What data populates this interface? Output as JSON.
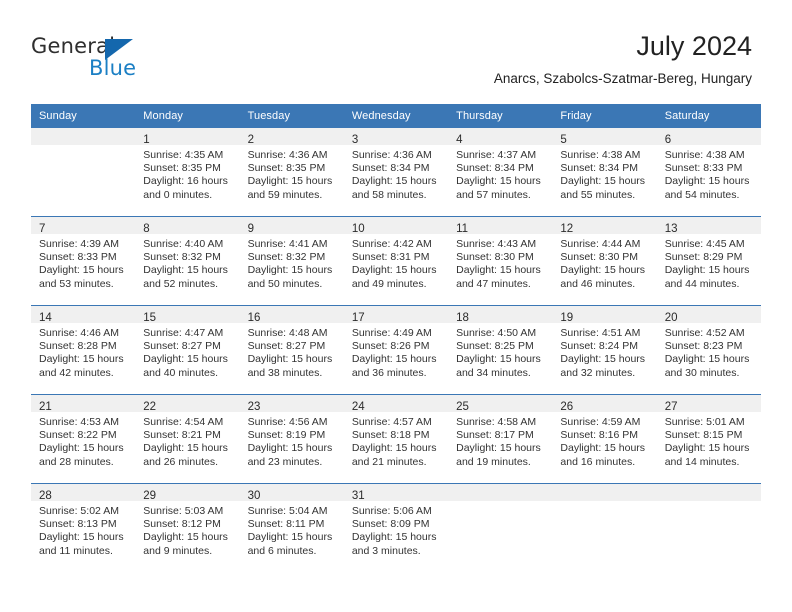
{
  "brand": {
    "name_top": "General",
    "name_bottom": "Blue",
    "mark": "triangle-flag",
    "color_primary": "#1467ad",
    "color_secondary": "#1b7fc4"
  },
  "header": {
    "title": "July 2024",
    "subtitle": "Anarcs, Szabolcs-Szatmar-Bereg, Hungary"
  },
  "calendar": {
    "accent_color": "#3b77b5",
    "band_color": "#f0f0f0",
    "weekday_headers": [
      "Sunday",
      "Monday",
      "Tuesday",
      "Wednesday",
      "Thursday",
      "Friday",
      "Saturday"
    ],
    "weeks": [
      [
        {
          "day": "",
          "sunrise": "",
          "sunset": "",
          "daylight_1": "",
          "daylight_2": ""
        },
        {
          "day": "1",
          "sunrise": "Sunrise: 4:35 AM",
          "sunset": "Sunset: 8:35 PM",
          "daylight_1": "Daylight: 16 hours",
          "daylight_2": "and 0 minutes."
        },
        {
          "day": "2",
          "sunrise": "Sunrise: 4:36 AM",
          "sunset": "Sunset: 8:35 PM",
          "daylight_1": "Daylight: 15 hours",
          "daylight_2": "and 59 minutes."
        },
        {
          "day": "3",
          "sunrise": "Sunrise: 4:36 AM",
          "sunset": "Sunset: 8:34 PM",
          "daylight_1": "Daylight: 15 hours",
          "daylight_2": "and 58 minutes."
        },
        {
          "day": "4",
          "sunrise": "Sunrise: 4:37 AM",
          "sunset": "Sunset: 8:34 PM",
          "daylight_1": "Daylight: 15 hours",
          "daylight_2": "and 57 minutes."
        },
        {
          "day": "5",
          "sunrise": "Sunrise: 4:38 AM",
          "sunset": "Sunset: 8:34 PM",
          "daylight_1": "Daylight: 15 hours",
          "daylight_2": "and 55 minutes."
        },
        {
          "day": "6",
          "sunrise": "Sunrise: 4:38 AM",
          "sunset": "Sunset: 8:33 PM",
          "daylight_1": "Daylight: 15 hours",
          "daylight_2": "and 54 minutes."
        }
      ],
      [
        {
          "day": "7",
          "sunrise": "Sunrise: 4:39 AM",
          "sunset": "Sunset: 8:33 PM",
          "daylight_1": "Daylight: 15 hours",
          "daylight_2": "and 53 minutes."
        },
        {
          "day": "8",
          "sunrise": "Sunrise: 4:40 AM",
          "sunset": "Sunset: 8:32 PM",
          "daylight_1": "Daylight: 15 hours",
          "daylight_2": "and 52 minutes."
        },
        {
          "day": "9",
          "sunrise": "Sunrise: 4:41 AM",
          "sunset": "Sunset: 8:32 PM",
          "daylight_1": "Daylight: 15 hours",
          "daylight_2": "and 50 minutes."
        },
        {
          "day": "10",
          "sunrise": "Sunrise: 4:42 AM",
          "sunset": "Sunset: 8:31 PM",
          "daylight_1": "Daylight: 15 hours",
          "daylight_2": "and 49 minutes."
        },
        {
          "day": "11",
          "sunrise": "Sunrise: 4:43 AM",
          "sunset": "Sunset: 8:30 PM",
          "daylight_1": "Daylight: 15 hours",
          "daylight_2": "and 47 minutes."
        },
        {
          "day": "12",
          "sunrise": "Sunrise: 4:44 AM",
          "sunset": "Sunset: 8:30 PM",
          "daylight_1": "Daylight: 15 hours",
          "daylight_2": "and 46 minutes."
        },
        {
          "day": "13",
          "sunrise": "Sunrise: 4:45 AM",
          "sunset": "Sunset: 8:29 PM",
          "daylight_1": "Daylight: 15 hours",
          "daylight_2": "and 44 minutes."
        }
      ],
      [
        {
          "day": "14",
          "sunrise": "Sunrise: 4:46 AM",
          "sunset": "Sunset: 8:28 PM",
          "daylight_1": "Daylight: 15 hours",
          "daylight_2": "and 42 minutes."
        },
        {
          "day": "15",
          "sunrise": "Sunrise: 4:47 AM",
          "sunset": "Sunset: 8:27 PM",
          "daylight_1": "Daylight: 15 hours",
          "daylight_2": "and 40 minutes."
        },
        {
          "day": "16",
          "sunrise": "Sunrise: 4:48 AM",
          "sunset": "Sunset: 8:27 PM",
          "daylight_1": "Daylight: 15 hours",
          "daylight_2": "and 38 minutes."
        },
        {
          "day": "17",
          "sunrise": "Sunrise: 4:49 AM",
          "sunset": "Sunset: 8:26 PM",
          "daylight_1": "Daylight: 15 hours",
          "daylight_2": "and 36 minutes."
        },
        {
          "day": "18",
          "sunrise": "Sunrise: 4:50 AM",
          "sunset": "Sunset: 8:25 PM",
          "daylight_1": "Daylight: 15 hours",
          "daylight_2": "and 34 minutes."
        },
        {
          "day": "19",
          "sunrise": "Sunrise: 4:51 AM",
          "sunset": "Sunset: 8:24 PM",
          "daylight_1": "Daylight: 15 hours",
          "daylight_2": "and 32 minutes."
        },
        {
          "day": "20",
          "sunrise": "Sunrise: 4:52 AM",
          "sunset": "Sunset: 8:23 PM",
          "daylight_1": "Daylight: 15 hours",
          "daylight_2": "and 30 minutes."
        }
      ],
      [
        {
          "day": "21",
          "sunrise": "Sunrise: 4:53 AM",
          "sunset": "Sunset: 8:22 PM",
          "daylight_1": "Daylight: 15 hours",
          "daylight_2": "and 28 minutes."
        },
        {
          "day": "22",
          "sunrise": "Sunrise: 4:54 AM",
          "sunset": "Sunset: 8:21 PM",
          "daylight_1": "Daylight: 15 hours",
          "daylight_2": "and 26 minutes."
        },
        {
          "day": "23",
          "sunrise": "Sunrise: 4:56 AM",
          "sunset": "Sunset: 8:19 PM",
          "daylight_1": "Daylight: 15 hours",
          "daylight_2": "and 23 minutes."
        },
        {
          "day": "24",
          "sunrise": "Sunrise: 4:57 AM",
          "sunset": "Sunset: 8:18 PM",
          "daylight_1": "Daylight: 15 hours",
          "daylight_2": "and 21 minutes."
        },
        {
          "day": "25",
          "sunrise": "Sunrise: 4:58 AM",
          "sunset": "Sunset: 8:17 PM",
          "daylight_1": "Daylight: 15 hours",
          "daylight_2": "and 19 minutes."
        },
        {
          "day": "26",
          "sunrise": "Sunrise: 4:59 AM",
          "sunset": "Sunset: 8:16 PM",
          "daylight_1": "Daylight: 15 hours",
          "daylight_2": "and 16 minutes."
        },
        {
          "day": "27",
          "sunrise": "Sunrise: 5:01 AM",
          "sunset": "Sunset: 8:15 PM",
          "daylight_1": "Daylight: 15 hours",
          "daylight_2": "and 14 minutes."
        }
      ],
      [
        {
          "day": "28",
          "sunrise": "Sunrise: 5:02 AM",
          "sunset": "Sunset: 8:13 PM",
          "daylight_1": "Daylight: 15 hours",
          "daylight_2": "and 11 minutes."
        },
        {
          "day": "29",
          "sunrise": "Sunrise: 5:03 AM",
          "sunset": "Sunset: 8:12 PM",
          "daylight_1": "Daylight: 15 hours",
          "daylight_2": "and 9 minutes."
        },
        {
          "day": "30",
          "sunrise": "Sunrise: 5:04 AM",
          "sunset": "Sunset: 8:11 PM",
          "daylight_1": "Daylight: 15 hours",
          "daylight_2": "and 6 minutes."
        },
        {
          "day": "31",
          "sunrise": "Sunrise: 5:06 AM",
          "sunset": "Sunset: 8:09 PM",
          "daylight_1": "Daylight: 15 hours",
          "daylight_2": "and 3 minutes."
        },
        {
          "day": "",
          "sunrise": "",
          "sunset": "",
          "daylight_1": "",
          "daylight_2": ""
        },
        {
          "day": "",
          "sunrise": "",
          "sunset": "",
          "daylight_1": "",
          "daylight_2": ""
        },
        {
          "day": "",
          "sunrise": "",
          "sunset": "",
          "daylight_1": "",
          "daylight_2": ""
        }
      ]
    ]
  }
}
